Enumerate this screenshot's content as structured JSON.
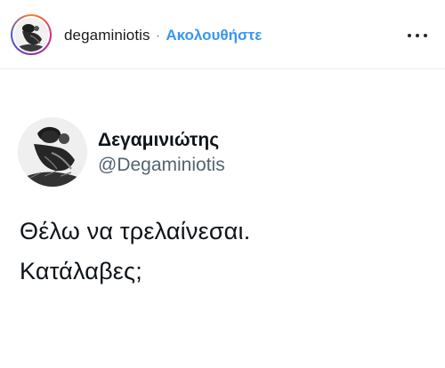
{
  "post_header": {
    "username": "degaminiotis",
    "separator": "·",
    "follow_label": "Ακολουθήστε"
  },
  "tweet": {
    "display_name": "Δεγαμινιώτης",
    "handle": "@Degaminiotis",
    "lines": [
      "Θέλω να τρελαίνεσαι.",
      "Κατάλαβες;"
    ]
  },
  "colors": {
    "follow_blue": "#3897f0",
    "handle_gray": "#536471",
    "text_dark": "#0f1419"
  },
  "icons": {
    "more": "more-options-icon",
    "avatar": "profile-illustration"
  }
}
